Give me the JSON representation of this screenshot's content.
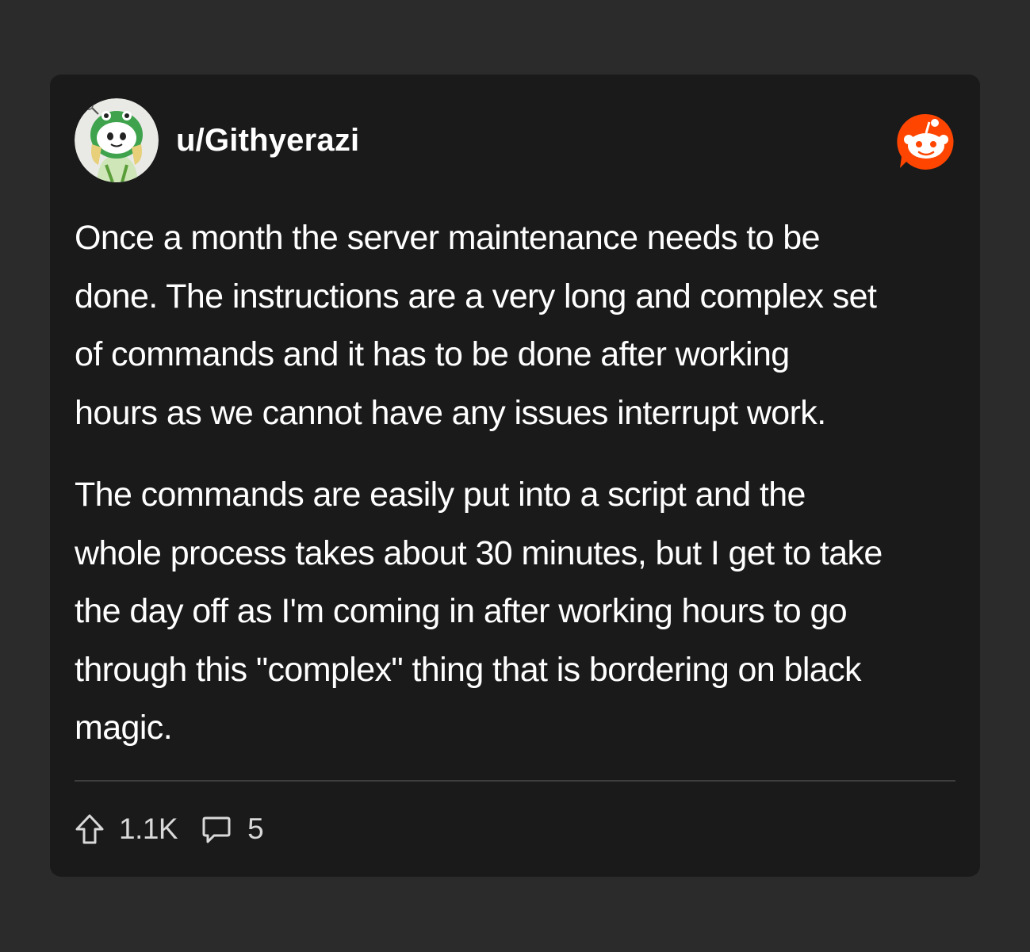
{
  "post": {
    "username": "u/Githyerazi",
    "paragraphs": [
      [
        "Once a month the server maintenance needs to be",
        "done. The instructions are a very long and complex set",
        "of commands and it has to be done after working",
        "hours as we cannot have any issues interrupt work."
      ],
      [
        "The commands are easily put into a script and the",
        "whole process takes about 30 minutes, but I get to take",
        "the day off as I'm coming in after working hours to go",
        "through this \"complex\" thing that is bordering on black",
        "magic."
      ]
    ]
  },
  "stats": {
    "upvotes": "1.1K",
    "comments": "5"
  },
  "icons": {
    "avatar": "snoo-avatar-icon",
    "brand": "reddit-logo-icon",
    "upvote": "upvote-arrow-icon",
    "comment": "comment-bubble-icon"
  },
  "colors": {
    "background": "#2b2b2b",
    "card": "#1a1a1a",
    "reddit_orange": "#ff4500",
    "text": "#ffffff",
    "muted": "#d9d9d9"
  }
}
